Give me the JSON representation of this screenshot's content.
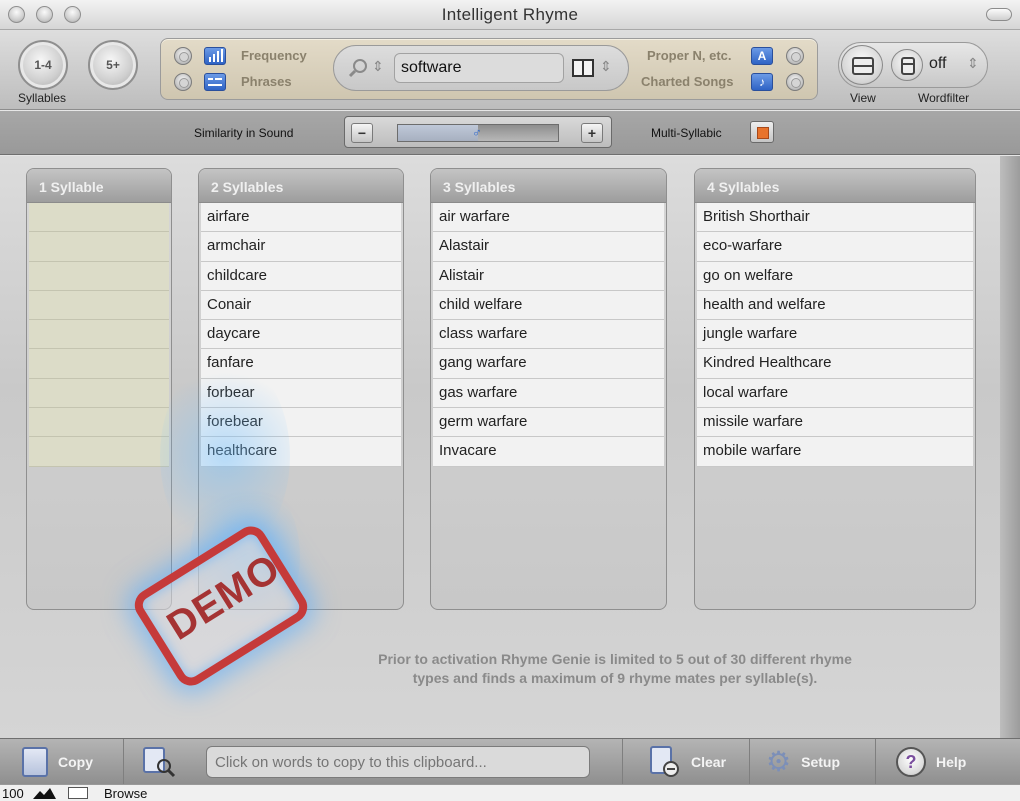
{
  "window": {
    "title": "Intelligent Rhyme"
  },
  "toolbar": {
    "syllables_btn_1": "1-4",
    "syllables_btn_2": "5+",
    "syllables_label": "Syllables",
    "frequency_label": "Frequency",
    "phrases_label": "Phrases",
    "search_value": "software",
    "proper_label": "Proper N, etc.",
    "charted_label": "Charted Songs",
    "view_label": "View",
    "wordfilter_label": "Wordfilter",
    "wordfilter_value": "off"
  },
  "similarity": {
    "label": "Similarity in Sound",
    "minus": "−",
    "plus": "+",
    "multi_label": "Multi-Syllabic",
    "level": 0.5
  },
  "columns": [
    {
      "header": "1 Syllable",
      "words": []
    },
    {
      "header": "2 Syllables",
      "words": [
        "airfare",
        "armchair",
        "childcare",
        "Conair",
        "daycare",
        "fanfare",
        "forbear",
        "forebear",
        "healthcare"
      ]
    },
    {
      "header": "3 Syllables",
      "words": [
        "air warfare",
        "Alastair",
        "Alistair",
        "child welfare",
        "class warfare",
        "gang warfare",
        "gas warfare",
        "germ warfare",
        "Invacare"
      ]
    },
    {
      "header": "4 Syllables",
      "words": [
        "British Shorthair",
        "eco-warfare",
        "go on welfare",
        "health and welfare",
        "jungle warfare",
        "Kindred Healthcare",
        "local warfare",
        "missile warfare",
        "mobile warfare"
      ]
    }
  ],
  "demo_stamp": "DEMO",
  "notice_line1": "Prior to activation Rhyme Genie is limited to 5 out of 30 different rhyme",
  "notice_line2": "types and finds a maximum of 9 rhyme mates per syllable(s).",
  "bottom": {
    "copy": "Copy",
    "clipboard_placeholder": "Click on words to copy to this clipboard...",
    "clear": "Clear",
    "setup": "Setup",
    "help": "Help"
  },
  "status": {
    "zoom": "100",
    "mode": "Browse"
  }
}
